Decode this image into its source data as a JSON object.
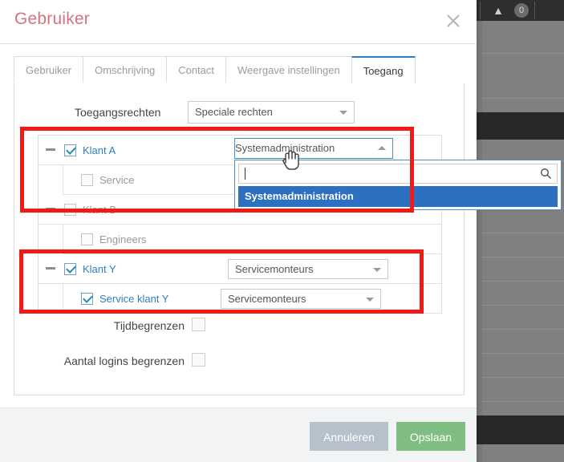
{
  "background_app": {
    "toolbar_icons": [
      "warning-triangle-icon",
      "notification-count-icon",
      "hamburger-menu-icon",
      "user-avatar-icon"
    ],
    "notification_count": "0"
  },
  "dialog": {
    "title": "Gebruiker",
    "close_icon": "close-icon",
    "tabs": [
      {
        "label": "Gebruiker",
        "active": false
      },
      {
        "label": "Omschrijving",
        "active": false
      },
      {
        "label": "Contact",
        "active": false
      },
      {
        "label": "Weergave instellingen",
        "active": false
      },
      {
        "label": "Toegang",
        "active": true
      }
    ],
    "access_rights": {
      "label": "Toegangsrechten",
      "value": "Speciale rechten",
      "caret_icon": "chevron-down-icon"
    },
    "tree": [
      {
        "label": "Klant A",
        "level": 0,
        "checked": true,
        "highlighted": true,
        "expander": "collapse-minus-icon",
        "role": "Systemadministration",
        "role_open": true
      },
      {
        "label": "Service",
        "level": 1,
        "checked": false,
        "highlighted": false,
        "expander": "",
        "role": "",
        "role_open": false
      },
      {
        "label": "Klant B",
        "level": 0,
        "checked": false,
        "highlighted": false,
        "expander": "collapse-minus-icon",
        "role": "",
        "role_open": false
      },
      {
        "label": "Engineers",
        "level": 1,
        "checked": false,
        "highlighted": false,
        "expander": "",
        "role": "",
        "role_open": false
      },
      {
        "label": "Klant Y",
        "level": 0,
        "checked": true,
        "highlighted": true,
        "expander": "collapse-minus-icon",
        "role": "Servicemonteurs",
        "role_open": false
      },
      {
        "label": "Service klant Y",
        "level": 1,
        "checked": true,
        "highlighted": true,
        "expander": "",
        "role": "Servicemonteurs",
        "role_open": false
      }
    ],
    "options": [
      {
        "label": "Tijdbegrenzen",
        "checked": false
      },
      {
        "label": "Aantal logins begrenzen",
        "checked": false
      }
    ],
    "footer": {
      "cancel_label": "Annuleren",
      "save_label": "Opslaan"
    }
  },
  "open_dropdown": {
    "selected_value": "Systemadministration",
    "caret_icon": "chevron-up-icon",
    "search_placeholder": "",
    "search_value": "",
    "search_icon": "search-icon",
    "options": [
      {
        "label": "Systemadministration",
        "selected": true
      }
    ]
  },
  "annotations": [
    {
      "name": "red-highlight-box-top"
    },
    {
      "name": "red-highlight-box-bottom"
    }
  ],
  "colors": {
    "title": "#d4737f",
    "accent_blue": "#2f7dc2",
    "dropdown_highlight": "#2d6fc0",
    "save_green": "#7fbd82",
    "cancel_grey": "#b6c1cb",
    "annotation_red": "#ee1b16"
  }
}
